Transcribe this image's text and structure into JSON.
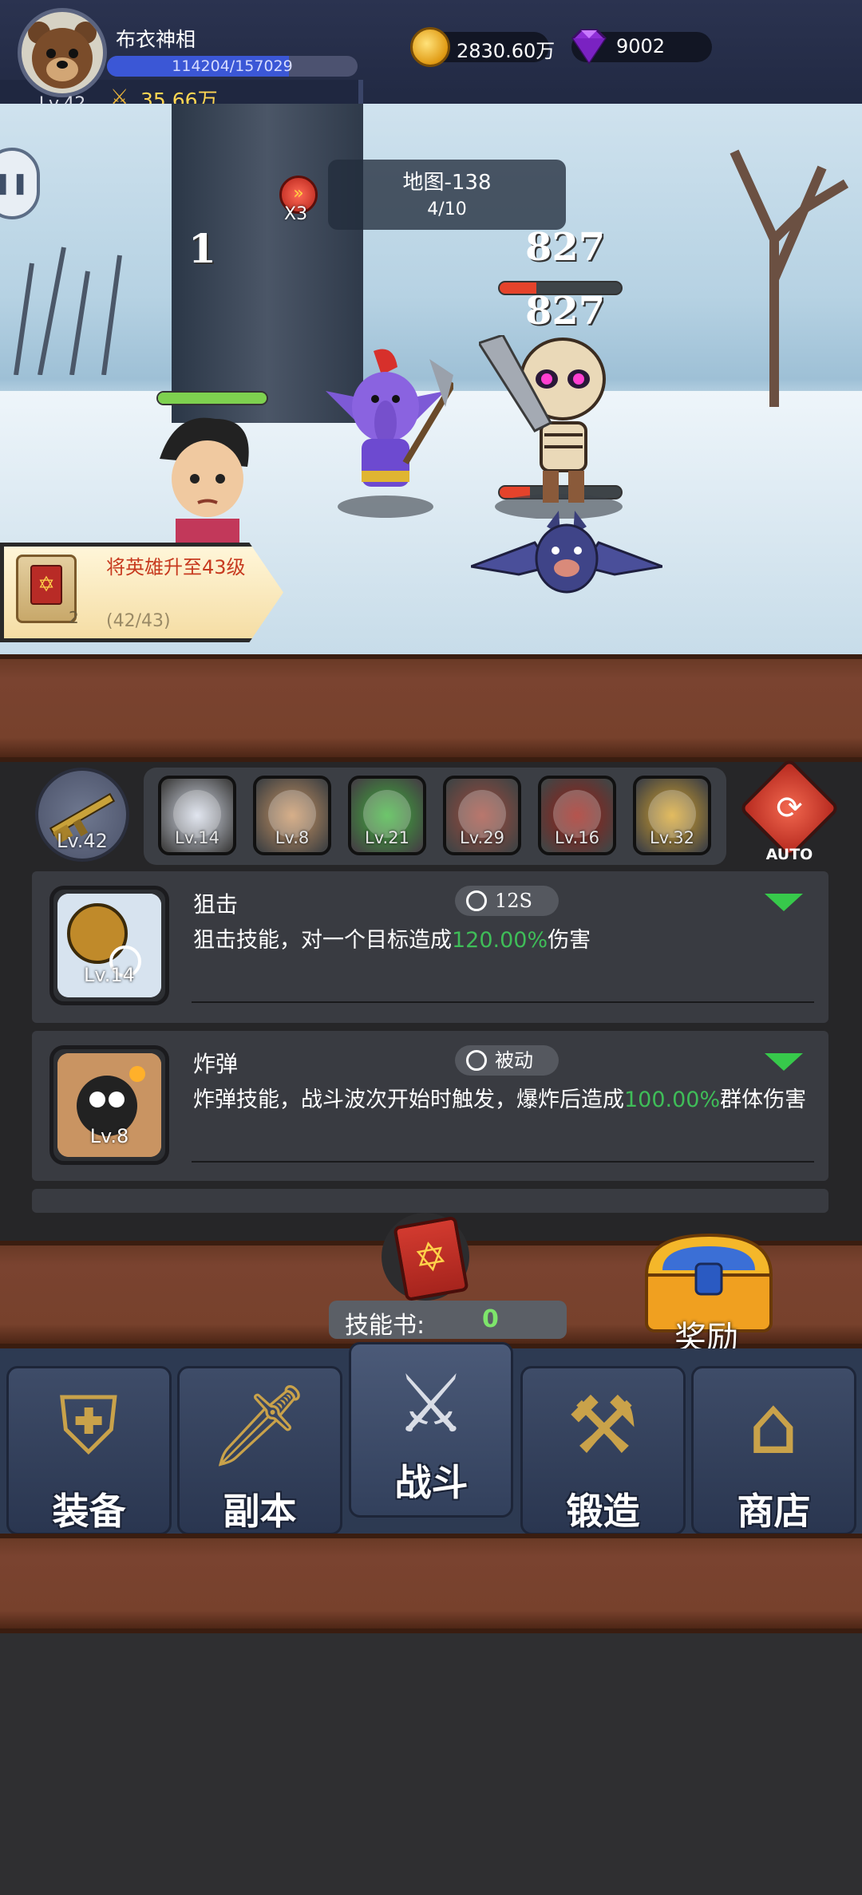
{
  "player": {
    "name": "布衣神相",
    "level": "Lv.42",
    "exp_text": "114204/157029",
    "exp_fraction": 0.727,
    "power": "35.66万"
  },
  "currency": {
    "gold": "2830.60万",
    "gems": "9002"
  },
  "battle": {
    "map_title": "地图-138",
    "wave": "4/10",
    "speed": "X3",
    "damage_numbers": [
      "1",
      "827",
      "827"
    ],
    "hero_hp_fraction": 1.0,
    "enemy_hp_fractions": [
      0.3,
      0.25
    ]
  },
  "task": {
    "title": "将英雄升至43级",
    "progress": "(42/43)",
    "reward_count": "2"
  },
  "weapon": {
    "level": "Lv.42"
  },
  "skill_slots": [
    {
      "level": "Lv.14",
      "color": "#d7ddea",
      "icon": "sniper-icon"
    },
    {
      "level": "Lv.8",
      "color": "#c99462",
      "icon": "bomb-icon"
    },
    {
      "level": "Lv.21",
      "color": "#3db33a",
      "icon": "poison-icon"
    },
    {
      "level": "Lv.29",
      "color": "#a24a3c",
      "icon": "fireball-icon"
    },
    {
      "level": "Lv.16",
      "color": "#9d1b12",
      "icon": "flame-icon"
    },
    {
      "level": "Lv.32",
      "color": "#d9a52a",
      "icon": "lightning-icon"
    }
  ],
  "auto_label": "AUTO",
  "skills": [
    {
      "name": "狙击",
      "level": "Lv.14",
      "time": "12S",
      "desc_pre": "狙击技能，对一个目标造成",
      "desc_value": "120.00%",
      "desc_post": "伤害"
    },
    {
      "name": "炸弹",
      "level": "Lv.8",
      "time": "被动",
      "desc_pre": "炸弹技能，战斗波次开始时触发，爆炸后造成",
      "desc_value": "100.00%",
      "desc_post": "群体伤害"
    }
  ],
  "skill_book": {
    "label": "技能书:",
    "count": "0"
  },
  "reward_label": "奖励",
  "nav": [
    {
      "label": "装备",
      "icon": "armor-icon"
    },
    {
      "label": "副本",
      "icon": "sword-shield-icon"
    },
    {
      "label": "战斗",
      "icon": "crossed-swords-icon"
    },
    {
      "label": "锻造",
      "icon": "scroll-hammer-icon"
    },
    {
      "label": "商店",
      "icon": "shop-icon"
    }
  ]
}
